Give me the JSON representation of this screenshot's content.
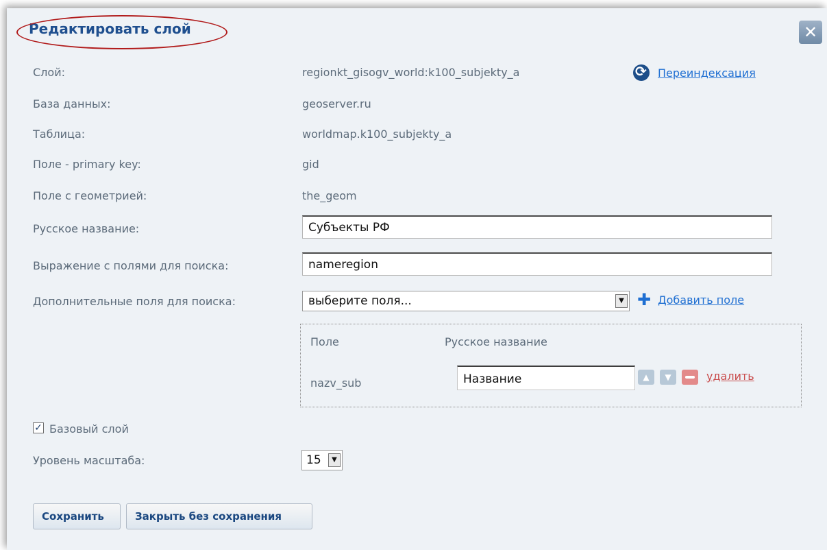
{
  "dialog": {
    "title": "Редактировать слой",
    "close_icon": "✕"
  },
  "fields": {
    "layer_label": "Слой:",
    "layer_value": "regionkt_gisogv_world:k100_subjekty_a",
    "reindex_label": "Переиндексация",
    "db_label": "База данных:",
    "db_value": "geoserver.ru",
    "table_label": "Таблица:",
    "table_value": "worldmap.k100_subjekty_a",
    "pk_label": "Поле - primary key:",
    "pk_value": "gid",
    "geom_label": "Поле с геометрией:",
    "geom_value": "the_geom",
    "ru_name_label": "Русское название:",
    "ru_name_value": "Субъекты РФ",
    "expr_label": "Выражение с полями для поиска:",
    "expr_value": "nameregion",
    "extra_label": "Дополнительные поля для поиска:",
    "extra_select_value": "выберите поля...",
    "add_field_label": "Добавить поле"
  },
  "extra_table": {
    "header_field": "Поле",
    "header_ru_name": "Русское название",
    "row_field": "nazv_sub",
    "row_ru_name": "Название",
    "delete_label": "удалить"
  },
  "base_layer": {
    "checked_mark": "✓",
    "label": "Базовый слой"
  },
  "scale": {
    "label": "Уровень масштаба:",
    "value": "15"
  },
  "buttons": {
    "save": "Сохранить",
    "close_no_save": "Закрыть без сохранения"
  }
}
